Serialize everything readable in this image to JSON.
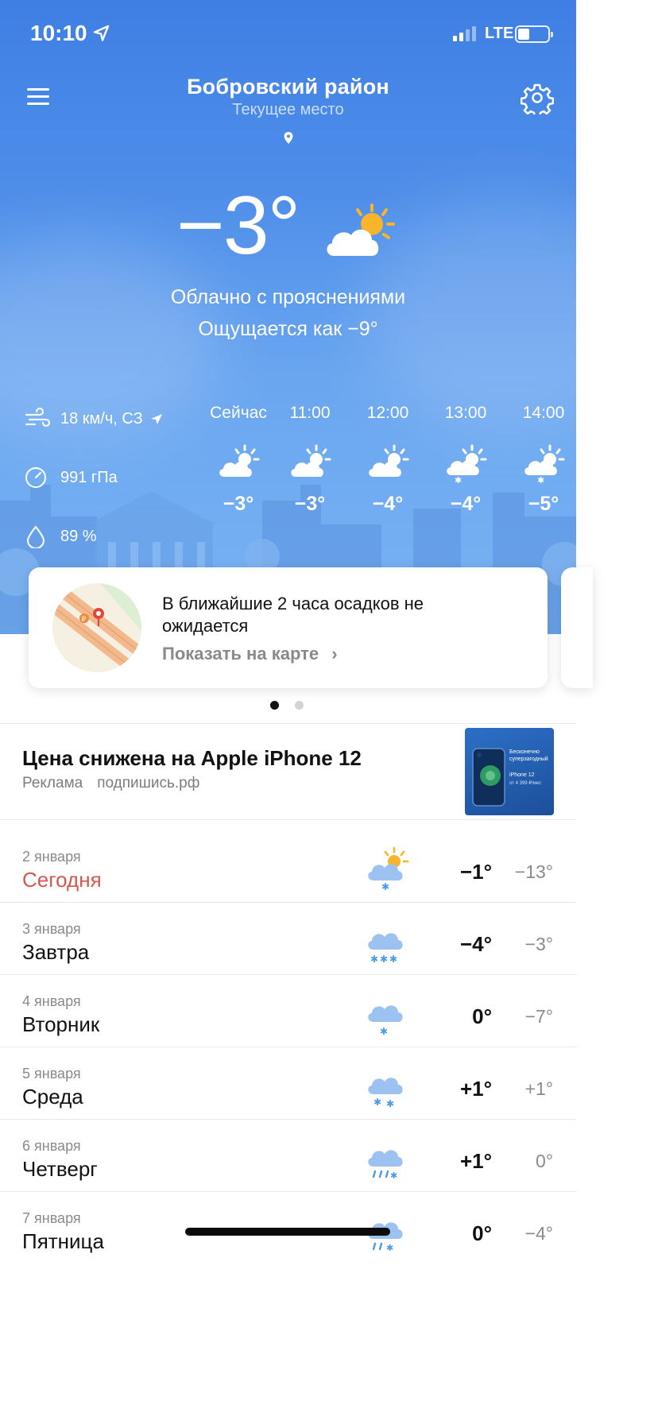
{
  "status_bar": {
    "time": "10:10",
    "network": "LTE",
    "battery_level": 0.4
  },
  "header": {
    "location": "Бобровский район",
    "subtitle": "Текущее место"
  },
  "current": {
    "temperature": "−3°",
    "condition": "Облачно с прояснениями",
    "feels_like": "Ощущается как −9°",
    "icon": "partly-cloudy-icon"
  },
  "stats": {
    "wind": "18 км/ч, СЗ",
    "pressure": "991 гПа",
    "humidity": "89 %"
  },
  "hourly": [
    {
      "time": "Сейчас",
      "temp": "−3°",
      "icon": "partly-cloudy-icon"
    },
    {
      "time": "11:00",
      "temp": "−3°",
      "icon": "partly-cloudy-icon"
    },
    {
      "time": "12:00",
      "temp": "−4°",
      "icon": "partly-cloudy-icon"
    },
    {
      "time": "13:00",
      "temp": "−4°",
      "icon": "partly-cloudy-light-snow-icon"
    },
    {
      "time": "14:00",
      "temp": "−5°",
      "icon": "partly-cloudy-light-snow-icon"
    }
  ],
  "precip_card": {
    "title": "В ближайшие 2 часа осадков не ожидается",
    "link": "Показать на карте"
  },
  "ad": {
    "title": "Цена снижена на Apple iPhone 12",
    "label": "Реклама",
    "source": "подпишись.рф",
    "thumb_text": [
      "Бесконечно суперзагодный",
      "iPhone 12",
      "от 4 399 ₽/мес"
    ]
  },
  "forecast": [
    {
      "date": "2 января",
      "day": "Сегодня",
      "hi": "−1°",
      "lo": "−13°",
      "icon": "partly-cloudy-snow-icon"
    },
    {
      "date": "3 января",
      "day": "Завтра",
      "hi": "−4°",
      "lo": "−3°",
      "icon": "snow-icon"
    },
    {
      "date": "4 января",
      "day": "Вторник",
      "hi": "0°",
      "lo": "−7°",
      "icon": "light-snow-icon"
    },
    {
      "date": "5 января",
      "day": "Среда",
      "hi": "+1°",
      "lo": "+1°",
      "icon": "snow-icon"
    },
    {
      "date": "6 января",
      "day": "Четверг",
      "hi": "+1°",
      "lo": "0°",
      "icon": "sleet-icon"
    },
    {
      "date": "7 января",
      "day": "Пятница",
      "hi": "0°",
      "lo": "−4°",
      "icon": "sleet-icon"
    }
  ],
  "colors": {
    "sky_top": "#3f7fe4",
    "sky_bottom": "#79b3f3",
    "today": "#d4584f",
    "sun": "#f7b52c"
  }
}
